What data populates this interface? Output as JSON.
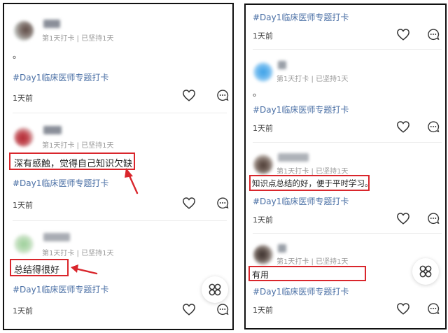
{
  "left": {
    "posts": [
      {
        "checkin": "第1天打卡 | 已坚持1天",
        "dot": "。",
        "content": "",
        "tag": "#Day1临床医师专题打卡",
        "time": "1天前"
      },
      {
        "checkin": "第1天打卡 | 已坚持1天",
        "dot": "",
        "content": "深有感触，觉得自己知识欠缺",
        "tag": "#Day1临床医师专题打卡",
        "time": "1天前"
      },
      {
        "checkin": "第1天打卡 | 已坚持1天",
        "dot": "",
        "content": "总结得很好",
        "tag": "#Day1临床医师专题打卡",
        "time": "1天前"
      }
    ]
  },
  "right": {
    "top_tag": "#Day1临床医师专题打卡",
    "top_time": "1天前",
    "posts": [
      {
        "checkin": "第1天打卡 | 已坚持1天",
        "dot": "。",
        "content": "",
        "tag": "#Day1临床医师专题打卡",
        "time": "1天前"
      },
      {
        "checkin": "第1天打卡 | 已坚持1天",
        "dot": "",
        "content": "知识点总结的好，便于平时学习。",
        "tag": "#Day1临床医师专题打卡",
        "time": "1天前"
      },
      {
        "checkin": "第1天打卡 | 已坚持1天",
        "dot": "",
        "content": "有用",
        "tag": "#Day1临床医师专题打卡",
        "time": "1天前"
      }
    ]
  },
  "colors": {
    "highlight": "#d9262c",
    "tag": "#4a6fa5"
  },
  "icons": [
    "heart-icon",
    "comment-icon",
    "clover-icon"
  ]
}
